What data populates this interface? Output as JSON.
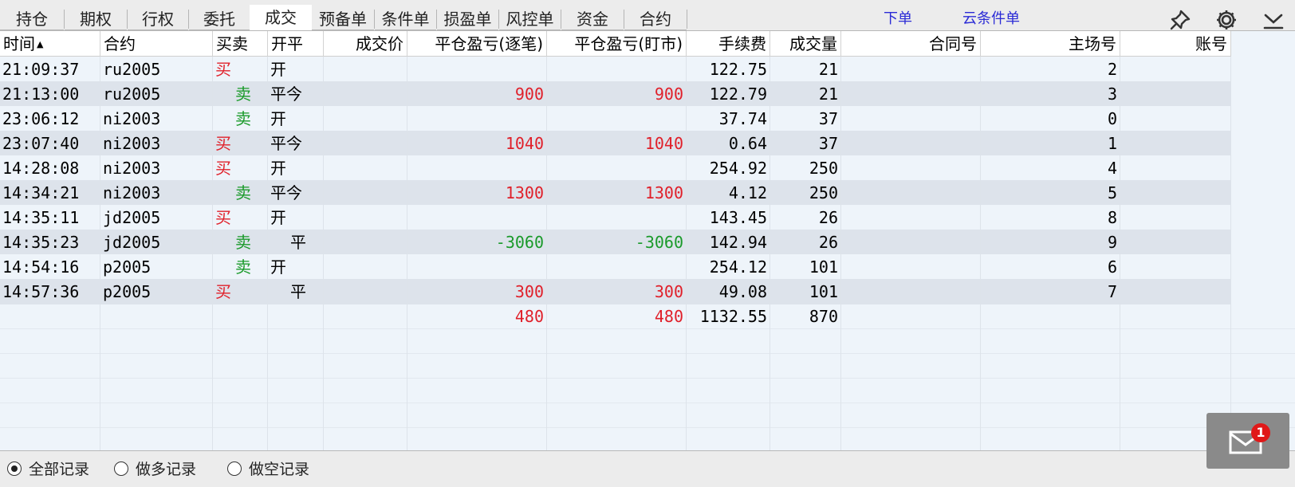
{
  "tabs": [
    "持仓",
    "期权",
    "行权",
    "委托",
    "成交",
    "预备单",
    "条件单",
    "损盈单",
    "风控单",
    "资金",
    "合约"
  ],
  "active_tab": 4,
  "links": {
    "order": "下单",
    "cloud": "云条件单"
  },
  "icons": {
    "pin": "pin-icon",
    "settings": "gear-icon",
    "menu": "chevron-down-icon",
    "mail": "envelope-icon"
  },
  "columns": [
    "时间",
    "合约",
    "买卖",
    "开平",
    "成交价",
    "平仓盈亏(逐笔)",
    "平仓盈亏(盯市)",
    "手续费",
    "成交量",
    "合同号",
    "主场号",
    "账号"
  ],
  "sort_indicator": "▲",
  "rows": [
    {
      "time": "21:09:37",
      "contract": "ru2005",
      "side": "买",
      "oc": "开",
      "price": "",
      "pnl_trade": "",
      "pnl_mark": "",
      "fee": "122.75",
      "qty": "21",
      "order_no": "",
      "seq": "2",
      "account": ""
    },
    {
      "time": "21:13:00",
      "contract": "ru2005",
      "side": "卖",
      "oc": "平今",
      "price": "",
      "pnl_trade": "900",
      "pnl_mark": "900",
      "fee": "122.79",
      "qty": "21",
      "order_no": "",
      "seq": "3",
      "account": ""
    },
    {
      "time": "23:06:12",
      "contract": "ni2003",
      "side": "卖",
      "oc": "开",
      "price": "",
      "pnl_trade": "",
      "pnl_mark": "",
      "fee": "37.74",
      "qty": "37",
      "order_no": "",
      "seq": "0",
      "account": ""
    },
    {
      "time": "23:07:40",
      "contract": "ni2003",
      "side": "买",
      "oc": "平今",
      "price": "",
      "pnl_trade": "1040",
      "pnl_mark": "1040",
      "fee": "0.64",
      "qty": "37",
      "order_no": "",
      "seq": "1",
      "account": ""
    },
    {
      "time": "14:28:08",
      "contract": "ni2003",
      "side": "买",
      "oc": "开",
      "price": "",
      "pnl_trade": "",
      "pnl_mark": "",
      "fee": "254.92",
      "qty": "250",
      "order_no": "",
      "seq": "4",
      "account": ""
    },
    {
      "time": "14:34:21",
      "contract": "ni2003",
      "side": "卖",
      "oc": "平今",
      "price": "",
      "pnl_trade": "1300",
      "pnl_mark": "1300",
      "fee": "4.12",
      "qty": "250",
      "order_no": "",
      "seq": "5",
      "account": ""
    },
    {
      "time": "14:35:11",
      "contract": "jd2005",
      "side": "买",
      "oc": "开",
      "price": "",
      "pnl_trade": "",
      "pnl_mark": "",
      "fee": "143.45",
      "qty": "26",
      "order_no": "",
      "seq": "8",
      "account": ""
    },
    {
      "time": "14:35:23",
      "contract": "jd2005",
      "side": "卖",
      "oc": "平",
      "price": "",
      "pnl_trade": "-3060",
      "pnl_mark": "-3060",
      "fee": "142.94",
      "qty": "26",
      "order_no": "",
      "seq": "9",
      "account": ""
    },
    {
      "time": "14:54:16",
      "contract": "p2005",
      "side": "卖",
      "oc": "开",
      "price": "",
      "pnl_trade": "",
      "pnl_mark": "",
      "fee": "254.12",
      "qty": "101",
      "order_no": "",
      "seq": "6",
      "account": ""
    },
    {
      "time": "14:57:36",
      "contract": "p2005",
      "side": "买",
      "oc": "平",
      "price": "",
      "pnl_trade": "300",
      "pnl_mark": "300",
      "fee": "49.08",
      "qty": "101",
      "order_no": "",
      "seq": "7",
      "account": ""
    }
  ],
  "totals": {
    "pnl_trade": "480",
    "pnl_mark": "480",
    "fee": "1132.55",
    "qty": "870"
  },
  "filters": [
    "全部记录",
    "做多记录",
    "做空记录"
  ],
  "selected_filter": 0,
  "mail_badge": "1",
  "colors": {
    "buy": "#e0202a",
    "sell": "#1a9a2a",
    "link": "#2b2bd6",
    "badge": "#e01818"
  }
}
